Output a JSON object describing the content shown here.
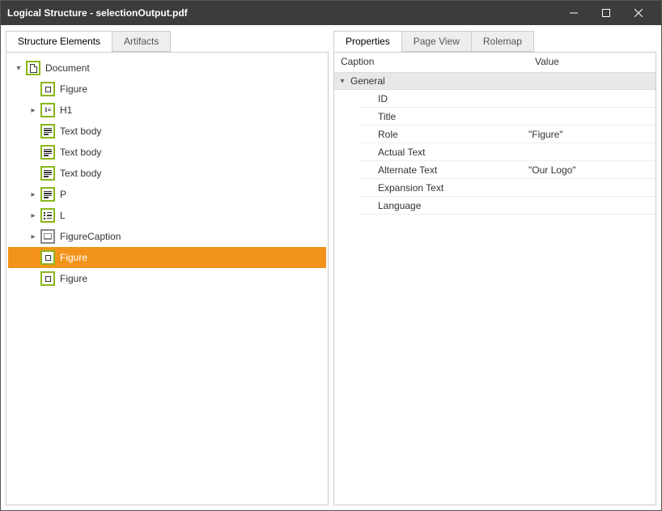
{
  "window": {
    "title": "Logical Structure - selectionOutput.pdf"
  },
  "leftTabs": {
    "structure": "Structure Elements",
    "artifacts": "Artifacts"
  },
  "rightTabs": {
    "properties": "Properties",
    "pageview": "Page View",
    "rolemap": "Rolemap"
  },
  "tree": {
    "root": {
      "label": "Document"
    },
    "children": [
      {
        "label": "Figure",
        "expandable": false,
        "icon": "square"
      },
      {
        "label": "H1",
        "expandable": true,
        "icon": "h1"
      },
      {
        "label": "Text body",
        "expandable": false,
        "icon": "text"
      },
      {
        "label": "Text body",
        "expandable": false,
        "icon": "text"
      },
      {
        "label": "Text body",
        "expandable": false,
        "icon": "text"
      },
      {
        "label": "P",
        "expandable": true,
        "icon": "text"
      },
      {
        "label": "L",
        "expandable": true,
        "icon": "list"
      },
      {
        "label": "FigureCaption",
        "expandable": true,
        "icon": "caption"
      },
      {
        "label": "Figure",
        "expandable": false,
        "icon": "square",
        "selected": true
      },
      {
        "label": "Figure",
        "expandable": false,
        "icon": "square"
      }
    ]
  },
  "propsHeader": {
    "caption": "Caption",
    "value": "Value"
  },
  "propsGroup": {
    "label": "General"
  },
  "props": [
    {
      "caption": "ID",
      "value": ""
    },
    {
      "caption": "Title",
      "value": ""
    },
    {
      "caption": "Role",
      "value": "\"Figure\""
    },
    {
      "caption": "Actual Text",
      "value": ""
    },
    {
      "caption": "Alternate Text",
      "value": "\"Our Logo\""
    },
    {
      "caption": "Expansion Text",
      "value": ""
    },
    {
      "caption": "Language",
      "value": ""
    }
  ]
}
